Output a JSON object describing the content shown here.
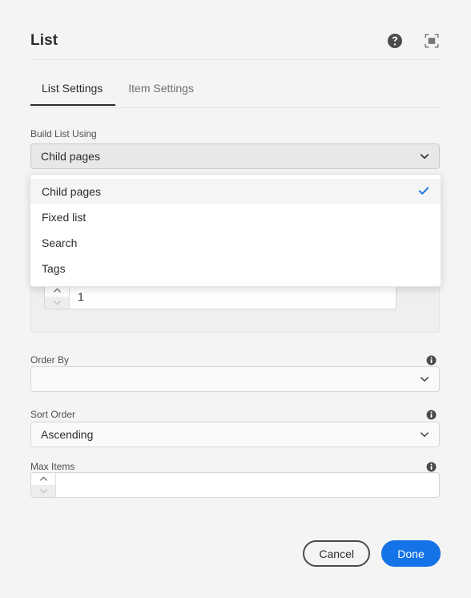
{
  "header": {
    "title": "List",
    "help_icon": "help-circle-icon",
    "fullscreen_icon": "fullscreen-icon"
  },
  "tabs": [
    {
      "label": "List Settings",
      "active": true
    },
    {
      "label": "Item Settings",
      "active": false
    }
  ],
  "build_list": {
    "label": "Build List Using",
    "value": "Child pages",
    "chevron_icon": "chevron-down-icon",
    "options": [
      {
        "label": "Child pages",
        "selected": true
      },
      {
        "label": "Fixed list",
        "selected": false
      },
      {
        "label": "Search",
        "selected": false
      },
      {
        "label": "Tags",
        "selected": false
      }
    ],
    "check_icon": "check-icon",
    "check_color": "#1473e6"
  },
  "child_depth": {
    "value": "1",
    "placeholder": "",
    "up_icon": "chevron-up-icon",
    "down_icon": "chevron-down-icon"
  },
  "order_by": {
    "label": "Order By",
    "value": "",
    "placeholder": "",
    "info_icon": "info-icon",
    "chevron_icon": "chevron-down-icon"
  },
  "sort_order": {
    "label": "Sort Order",
    "value": "Ascending",
    "info_icon": "info-icon",
    "chevron_icon": "chevron-down-icon"
  },
  "max_items": {
    "label": "Max Items",
    "value": "",
    "placeholder": "",
    "info_icon": "info-icon",
    "up_icon": "chevron-up-icon",
    "down_icon": "chevron-down-icon"
  },
  "footer": {
    "cancel_label": "Cancel",
    "done_label": "Done",
    "accent_color": "#1473e6"
  }
}
